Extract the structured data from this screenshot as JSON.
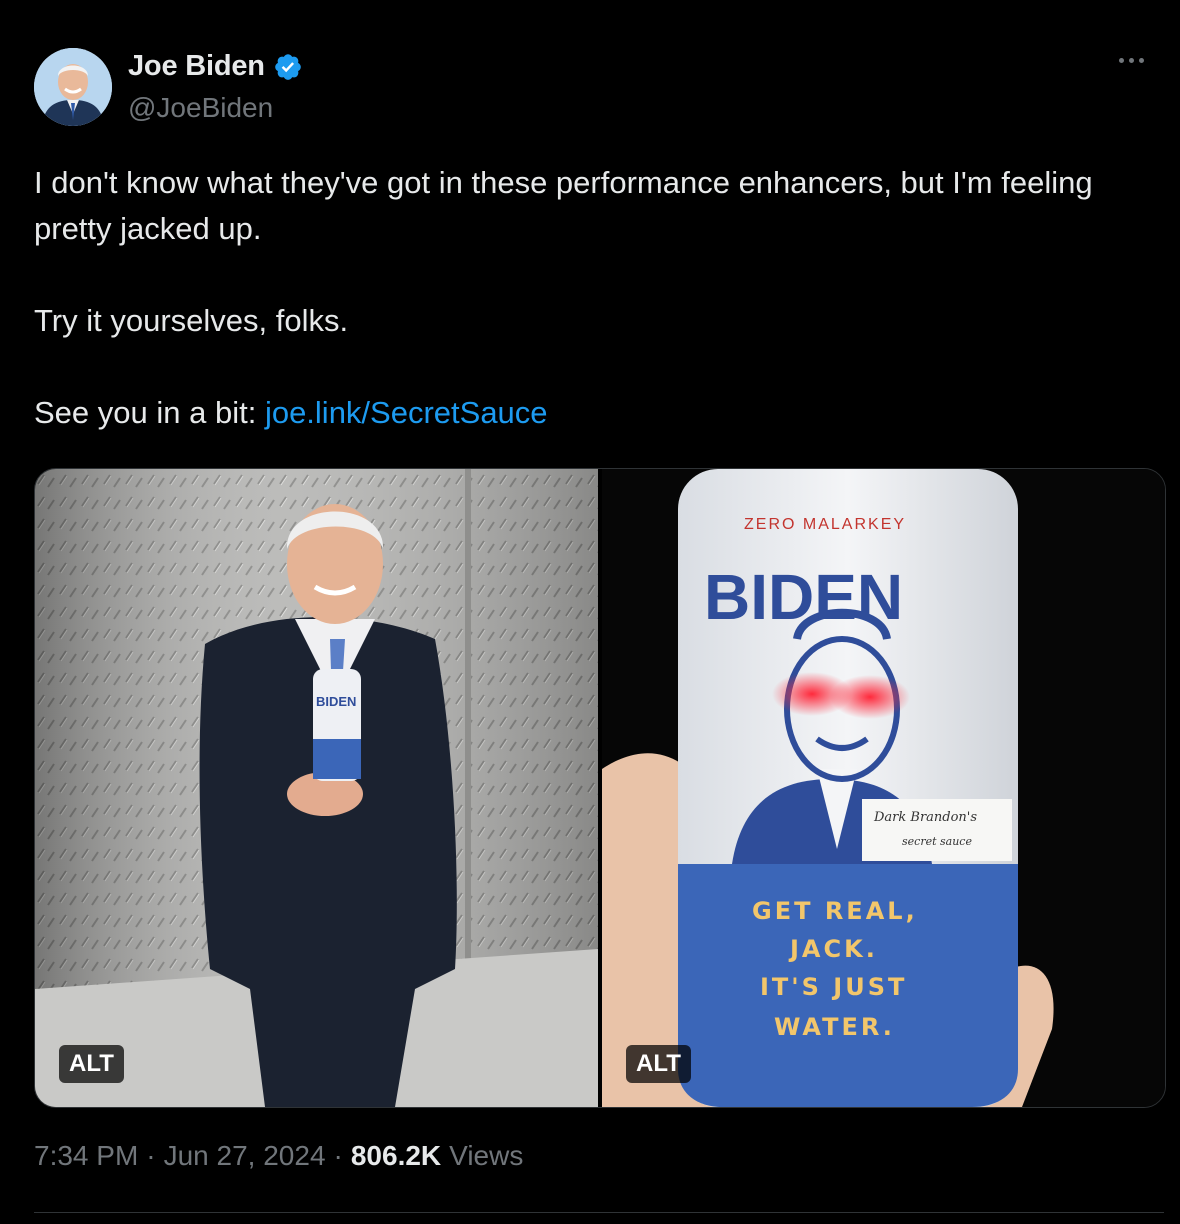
{
  "author": {
    "display_name": "Joe Biden",
    "handle": "@JoeBiden",
    "verified_icon": "verified-badge-icon",
    "avatar_icon": "avatar"
  },
  "more_icon": "more-options-icon",
  "tweet": {
    "line1": "I don't know what they've got in these performance enhancers, but I'm feeling pretty jacked up.",
    "line2": "Try it yourselves, folks.",
    "line3_prefix": "See you in a bit: ",
    "link_text": "joe.link/SecretSauce"
  },
  "media": {
    "left_alt": "ALT",
    "right_alt": "ALT",
    "can_small_label": "BIDEN",
    "can_top_text": "ZERO MALARKEY",
    "can_brand": "BIDEN",
    "can_handwriting_1": "Dark Brandon's",
    "can_handwriting_2": "secret sauce",
    "can_slogan_1": "GET REAL,",
    "can_slogan_2": "JACK.",
    "can_slogan_3": "IT'S JUST",
    "can_slogan_4": "WATER."
  },
  "meta": {
    "time": "7:34 PM",
    "sep1": "·",
    "date": "Jun 27, 2024",
    "sep2": "·",
    "views_count": "806.2K",
    "views_label": "Views"
  },
  "colors": {
    "background": "#000000",
    "text": "#e7e9ea",
    "secondary": "#71767b",
    "link": "#1d9bf0",
    "verified": "#1d9bf0",
    "can_blue": "#3b66b8"
  }
}
